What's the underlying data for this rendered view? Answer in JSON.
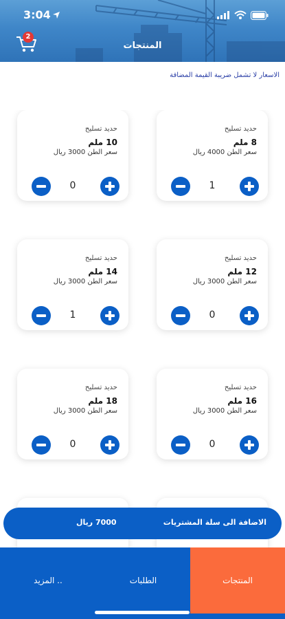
{
  "status_bar": {
    "time": "3:04"
  },
  "header": {
    "title": "المنتجات",
    "cart_count": "2"
  },
  "vat_note": "الاسعار لا تشمل ضريبة القيمة المضافة",
  "products": [
    {
      "kind": "حديد تسليح",
      "size": "8 ملم",
      "price": "سعر الطن 4000 ريال",
      "qty": "1"
    },
    {
      "kind": "حديد تسليح",
      "size": "10 ملم",
      "price": "سعر الطن 3000 ريال",
      "qty": "0"
    },
    {
      "kind": "حديد تسليح",
      "size": "12 ملم",
      "price": "سعر الطن 3000 ريال",
      "qty": "0"
    },
    {
      "kind": "حديد تسليح",
      "size": "14 ملم",
      "price": "سعر الطن 3000 ريال",
      "qty": "1"
    },
    {
      "kind": "حديد تسليح",
      "size": "16 ملم",
      "price": "سعر الطن 3000 ريال",
      "qty": "0"
    },
    {
      "kind": "حديد تسليح",
      "size": "18 ملم",
      "price": "سعر الطن 3000 ريال",
      "qty": "0"
    }
  ],
  "cart_bar": {
    "label": "الاضافة الى سلة المشتريات",
    "total": "7000 ريال"
  },
  "bottom_nav": {
    "products": "المنتجات",
    "orders": "الطلبات",
    "more": "المزيد .."
  },
  "colors": {
    "primary": "#0b5fc6",
    "accent": "#fb6b3c",
    "badge": "#e53935"
  },
  "icons": {
    "cart": "cart-icon",
    "plus": "plus-circle-icon",
    "minus": "minus-circle-icon"
  }
}
